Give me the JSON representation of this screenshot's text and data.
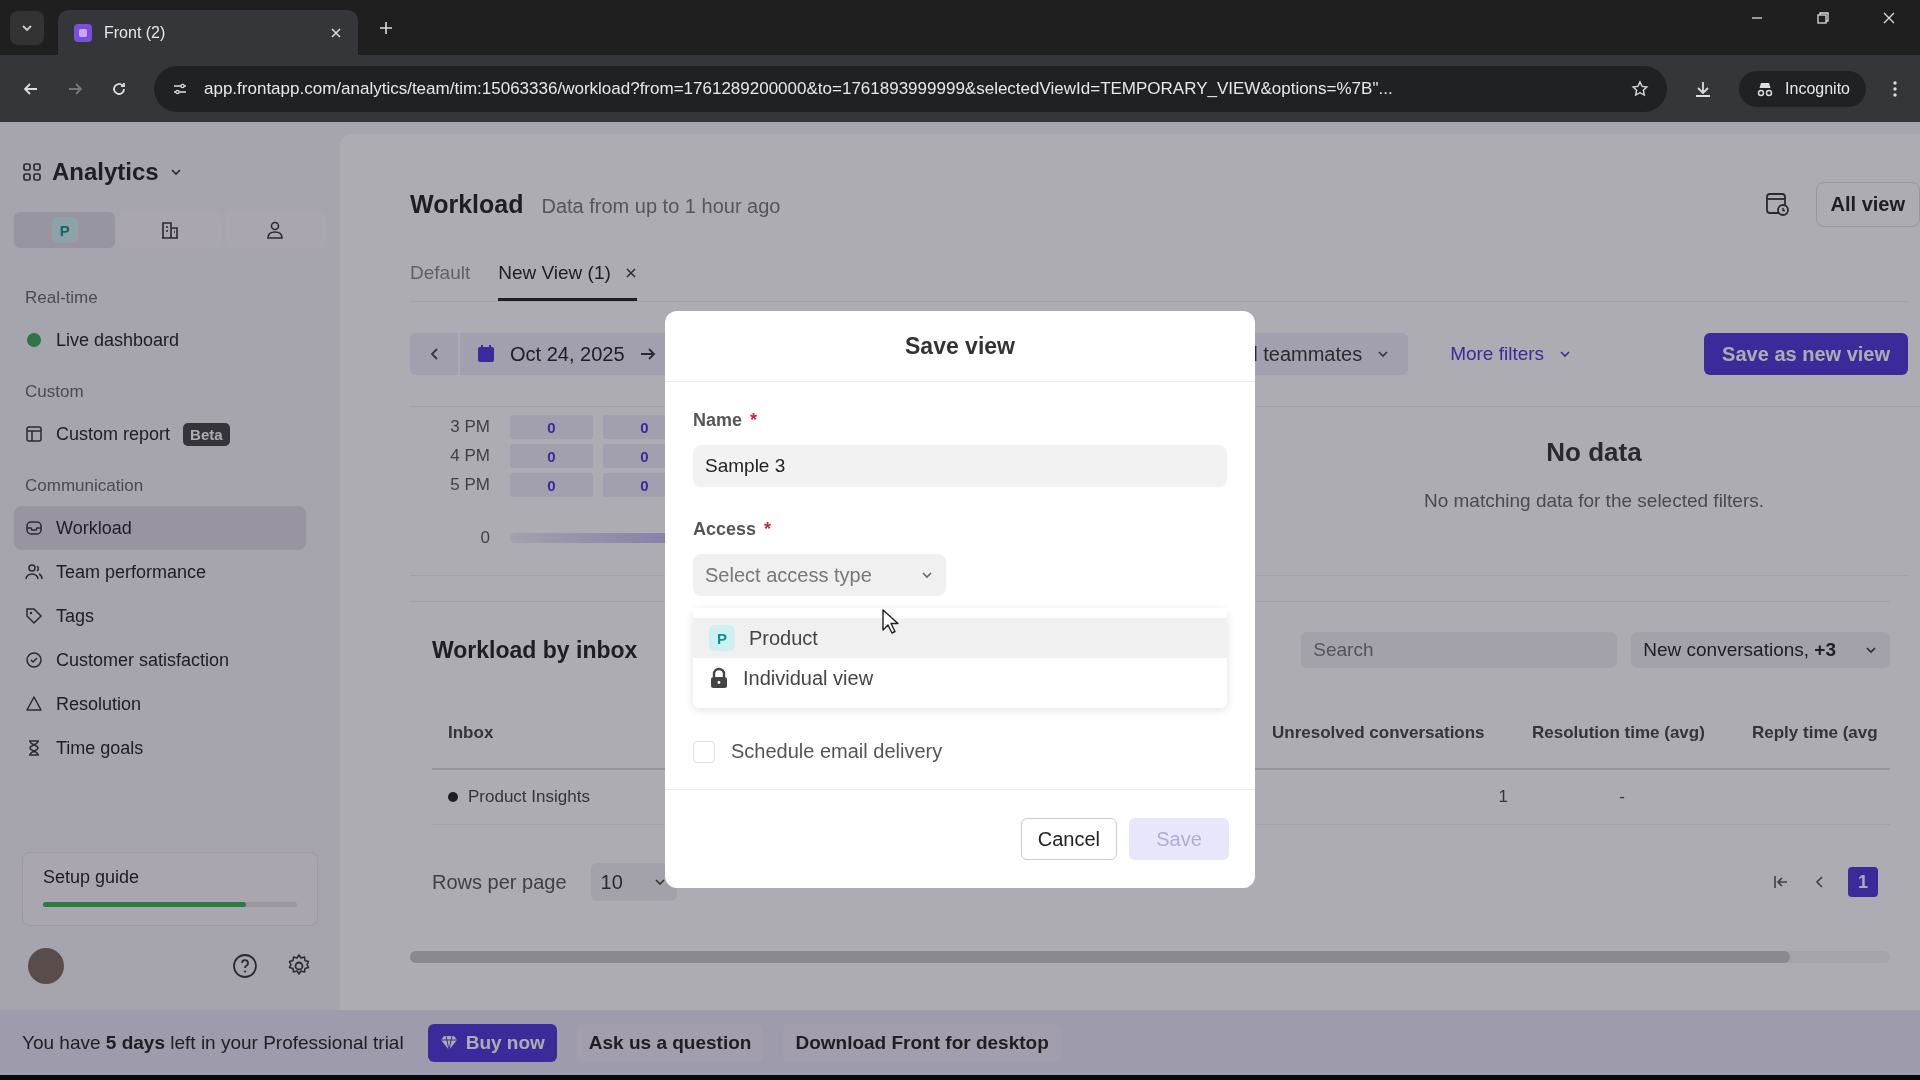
{
  "browser": {
    "tab_title": "Front (2)",
    "url": "app.frontapp.com/analytics/team/tim:15063336/workload?from=1761289200000&to=1761893999999&selectedViewId=TEMPORARY_VIEW&options=%7B\"...",
    "profile": "Incognito"
  },
  "sidebar": {
    "title": "Analytics",
    "scope_tabs": [
      {
        "kind": "avatar",
        "letter": "P",
        "selected": true
      },
      {
        "kind": "building",
        "selected": false
      },
      {
        "kind": "person",
        "selected": false
      }
    ],
    "sections": [
      {
        "heading": "Real-time",
        "items": [
          {
            "kind": "status",
            "label": "Live dashboard",
            "selected": false
          }
        ]
      },
      {
        "heading": "Custom",
        "items": [
          {
            "kind": "report",
            "label": "Custom report",
            "badge": "Beta",
            "selected": false
          }
        ]
      },
      {
        "heading": "Communication",
        "items": [
          {
            "kind": "inbox",
            "label": "Workload",
            "selected": true
          },
          {
            "kind": "team",
            "label": "Team performance",
            "selected": false
          },
          {
            "kind": "tag",
            "label": "Tags",
            "selected": false
          },
          {
            "kind": "satisfaction",
            "label": "Customer satisfaction",
            "selected": false
          },
          {
            "kind": "resolution",
            "label": "Resolution",
            "selected": false
          },
          {
            "kind": "timer",
            "label": "Time goals",
            "selected": false
          }
        ]
      }
    ],
    "setup_guide": {
      "label": "Setup guide",
      "level": 0.8
    }
  },
  "page": {
    "title": "Workload",
    "subtitle": "Data from up to 1 hour ago",
    "all_views": "All view",
    "view_tabs": [
      {
        "label": "Default",
        "selected": false,
        "closable": false
      },
      {
        "label": "New View (1)",
        "selected": true,
        "closable": true
      }
    ],
    "filters": {
      "date": "Oct 24, 2025",
      "teammates": "l teammates",
      "more_filters": "More filters",
      "save_new": "Save as new view"
    },
    "heatmap": {
      "rows": [
        {
          "label": "3 PM",
          "cells": [
            "0",
            "0"
          ]
        },
        {
          "label": "4 PM",
          "cells": [
            "0",
            "0"
          ]
        },
        {
          "label": "5 PM",
          "cells": [
            "0",
            "0"
          ]
        }
      ],
      "legend_min": "0"
    },
    "empty_state": {
      "title": "No data",
      "message": "No matching data for the selected filters."
    },
    "inbox_table": {
      "title": "Workload by inbox",
      "search_placeholder": "Search",
      "metrics": "New conversations, **+3**",
      "columns": [
        "Inbox",
        "Unresolved conversations",
        "Resolution time (avg)",
        "Reply time (avg"
      ],
      "rows": [
        {
          "cells": [
            "Product Insights",
            "1",
            "-"
          ]
        }
      ],
      "rows_per_page_label": "Rows per page",
      "rows_per_page": "10",
      "pages": [
        {
          "label": "1",
          "selected": true
        }
      ]
    }
  },
  "trial_bar": {
    "message": "You have **5 days** left in your Professional trial",
    "buy": "Buy now",
    "ask": "Ask us a question",
    "download": "Download Front for desktop"
  },
  "dialog": {
    "title": "Save view",
    "name_field": {
      "label": "Name",
      "required_mark": "*",
      "value": "Sample 3"
    },
    "access_field": {
      "label": "Access",
      "required_mark": "*",
      "placeholder": "Select access type"
    },
    "access_options": [
      {
        "kind": "avatar",
        "letter": "P",
        "label": "Product",
        "highlighted": true
      },
      {
        "kind": "lock",
        "label": "Individual view",
        "highlighted": false
      }
    ],
    "schedule": {
      "label": "Schedule email delivery",
      "checked": false
    },
    "buttons": [
      {
        "kind": "secondary",
        "label": "Cancel",
        "disabled": false
      },
      {
        "kind": "primary",
        "label": "Save",
        "disabled": true
      }
    ]
  }
}
